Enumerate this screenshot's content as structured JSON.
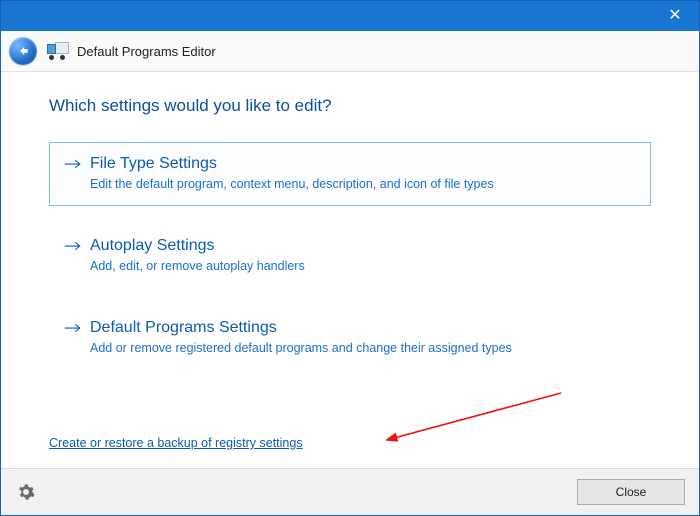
{
  "titlebar": {},
  "header": {
    "app_title": "Default Programs Editor"
  },
  "main": {
    "heading": "Which settings would you like to edit?",
    "options": [
      {
        "title": "File Type Settings",
        "desc": "Edit the default program, context menu, description, and icon of file types",
        "selected": true
      },
      {
        "title": "Autoplay Settings",
        "desc": "Add, edit, or remove autoplay handlers",
        "selected": false
      },
      {
        "title": "Default Programs Settings",
        "desc": "Add or remove registered default programs and change their assigned types",
        "selected": false
      }
    ],
    "backup_link": "Create or restore a backup of registry settings"
  },
  "footer": {
    "close_label": "Close"
  }
}
